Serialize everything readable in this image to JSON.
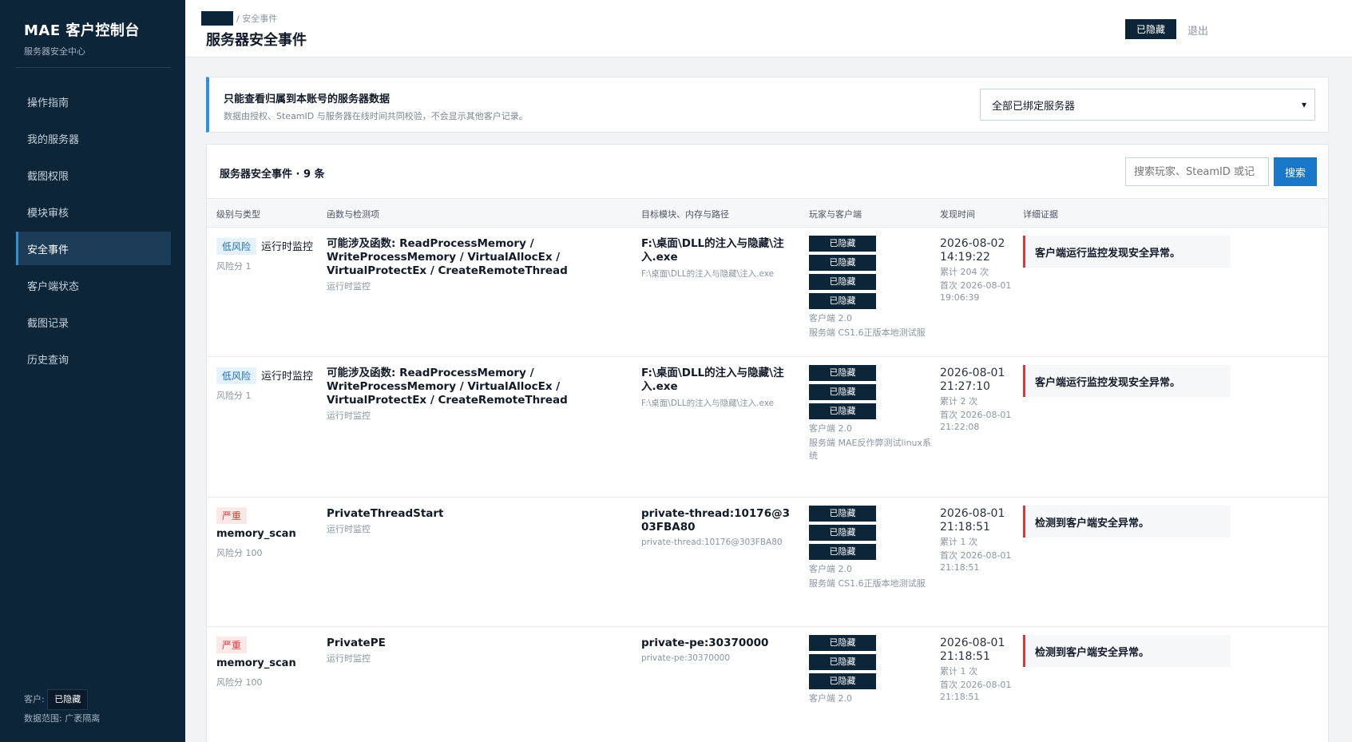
{
  "sidebar": {
    "brand_title": "MAE 客户控制台",
    "brand_sub": "服务器安全中心",
    "items": [
      {
        "label": "操作指南"
      },
      {
        "label": "我的服务器"
      },
      {
        "label": "截图权限"
      },
      {
        "label": "模块审核"
      },
      {
        "label": "安全事件"
      },
      {
        "label": "客户端状态"
      },
      {
        "label": "截图记录"
      },
      {
        "label": "历史查询"
      }
    ],
    "footer_client_label": "客户:",
    "footer_client_value": "已隐藏",
    "footer_scope": "数据范围: 广袤隔离"
  },
  "header": {
    "breadcrumb": "/ 安全事件",
    "title": "服务器安全事件",
    "user_badge": "已隐藏",
    "logout": "退出"
  },
  "notice": {
    "title": "只能查看归属到本账号的服务器数据",
    "desc": "数据由授权、SteamID 与服务器在线时间共同校验，不会显示其他客户记录。",
    "select_value": "全部已绑定服务器"
  },
  "events": {
    "title": "服务器安全事件 · 9 条",
    "search_placeholder": "搜索玩家、SteamID 或记",
    "search_button": "搜索",
    "columns": [
      "级别与类型",
      "函数与检测项",
      "目标模块、内存与路径",
      "玩家与客户端",
      "发现时间",
      "详细证据"
    ],
    "rows": [
      {
        "level": "低风险",
        "type": "运行时监控",
        "score": "风险分 1",
        "func": "可能涉及函数: ReadProcessMemory / WriteProcessMemory / VirtualAllocEx / VirtualProtectEx / CreateRemoteThread",
        "func_sub": "运行时监控",
        "target": "F:\\桌面\\DLL的注入与隐藏\\注入.exe",
        "target_sub": "F:\\桌面\\DLL的注入与隐藏\\注入.exe",
        "players": [
          "已隐藏",
          "已隐藏",
          "已隐藏",
          "已隐藏"
        ],
        "client": "客户端 2.0",
        "server": "服务端 CS1.6正版本地测试服",
        "time": "2026-08-02 14:19:22",
        "count": "累计 204 次",
        "first": "首次 2026-08-01 19:06:39",
        "evidence": "客户端运行监控发现安全异常。"
      },
      {
        "level": "低风险",
        "type": "运行时监控",
        "score": "风险分 1",
        "func": "可能涉及函数: ReadProcessMemory / WriteProcessMemory / VirtualAllocEx / VirtualProtectEx / CreateRemoteThread",
        "func_sub": "运行时监控",
        "target": "F:\\桌面\\DLL的注入与隐藏\\注入.exe",
        "target_sub": "F:\\桌面\\DLL的注入与隐藏\\注入.exe",
        "players": [
          "已隐藏",
          "已隐藏",
          "已隐藏"
        ],
        "client": "客户端 2.0",
        "server": "服务端 MAE反作弊测试linux系统",
        "time": "2026-08-01 21:27:10",
        "count": "累计 2 次",
        "first": "首次 2026-08-01 21:22:08",
        "evidence": "客户端运行监控发现安全异常。"
      },
      {
        "level": "严重",
        "type": "memory_scan",
        "score": "风险分 100",
        "func": "PrivateThreadStart",
        "func_sub": "运行时监控",
        "target": "private-thread:10176@303FBA80",
        "target_sub": "private-thread:10176@303FBA80",
        "players": [
          "已隐藏",
          "已隐藏",
          "已隐藏"
        ],
        "client": "客户端 2.0",
        "server": "服务端 CS1.6正版本地测试服",
        "time": "2026-08-01 21:18:51",
        "count": "累计 1 次",
        "first": "首次 2026-08-01 21:18:51",
        "evidence": "检测到客户端安全异常。"
      },
      {
        "level": "严重",
        "type": "memory_scan",
        "score": "风险分 100",
        "func": "PrivatePE",
        "func_sub": "运行时监控",
        "target": "private-pe:30370000",
        "target_sub": "private-pe:30370000",
        "players": [
          "已隐藏",
          "已隐藏",
          "已隐藏"
        ],
        "client": "客户端 2.0",
        "server": "",
        "time": "2026-08-01 21:18:51",
        "count": "累计 1 次",
        "first": "首次 2026-08-01 21:18:51",
        "evidence": "检测到客户端安全异常。"
      }
    ]
  }
}
